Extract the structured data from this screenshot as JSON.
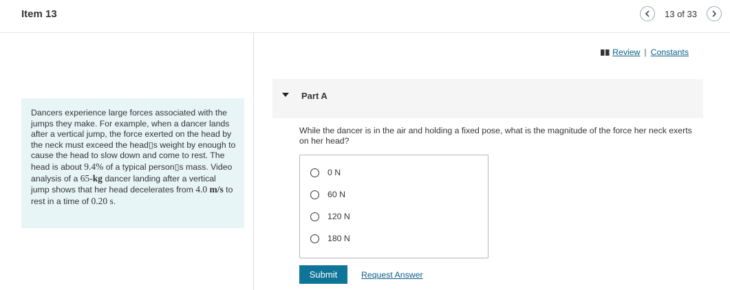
{
  "header": {
    "item_title": "Item 13",
    "page_count": "13 of 33",
    "prev_icon": "chevron-left-icon",
    "next_icon": "chevron-right-icon"
  },
  "problem": {
    "seg1": "Dancers experience large forces associated with the jumps they make. For example, when a dancer lands after a vertical jump, the force exerted on the head by the neck must exceed the head",
    "apos1": "▯",
    "seg2": "s weight by enough to cause the head to slow down and come to rest. The head is about ",
    "percent": "9.4%",
    "seg3": " of a typical person",
    "apos2": "▯",
    "seg4": "s mass. Video analysis of a ",
    "mass_num": "65-",
    "mass_unit": "kg",
    "seg5": " dancer landing after a vertical jump shows that her head decelerates from ",
    "speed_num": "4.0 ",
    "speed_unit": "m/s",
    "seg6": " to rest in a time of ",
    "time_num": "0.20 ",
    "time_unit": "s",
    "seg7": "."
  },
  "links": {
    "review": "Review",
    "separator": "|",
    "constants": "Constants",
    "book_icon": "book-icon"
  },
  "part": {
    "title": "Part A",
    "caret_icon": "caret-down-icon"
  },
  "question": "While the dancer is in the air and holding a fixed pose, what is the magnitude of the force her neck exerts on her head?",
  "choices": [
    "0 N",
    "60 N",
    "120 N",
    "180 N"
  ],
  "actions": {
    "submit": "Submit",
    "request_answer": "Request Answer"
  },
  "colors": {
    "accent": "#0e7598",
    "link": "#0a5f87",
    "problem_bg": "#e8f5f6"
  }
}
